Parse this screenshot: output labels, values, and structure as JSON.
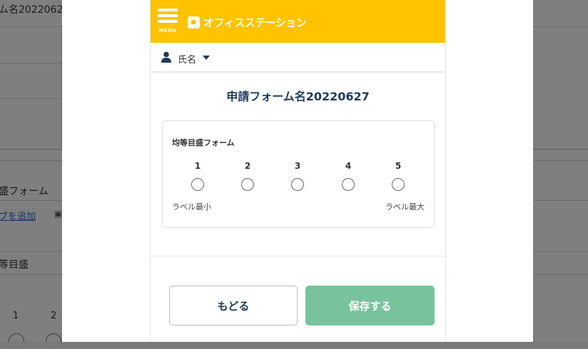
{
  "background": {
    "title": "ム名20220627",
    "field_name": "盛フォーム",
    "add_link": "ブを追加",
    "image_link": "",
    "section_label": "等目盛",
    "numbers": [
      "1",
      "2"
    ]
  },
  "header": {
    "menu_label": "MENU",
    "logo_text": "オフィスステーション"
  },
  "user": {
    "name_label": "氏名"
  },
  "form": {
    "title": "申請フォーム名20220627",
    "question_label": "均等目盛フォーム",
    "scale": [
      "1",
      "2",
      "3",
      "4",
      "5"
    ],
    "label_min": "ラベル最小",
    "label_max": "ラベル最大"
  },
  "buttons": {
    "back": "もどる",
    "save": "保存する"
  },
  "colors": {
    "header": "#ffc300",
    "save_button": "#78c39c",
    "title_text": "#1d3b58"
  }
}
